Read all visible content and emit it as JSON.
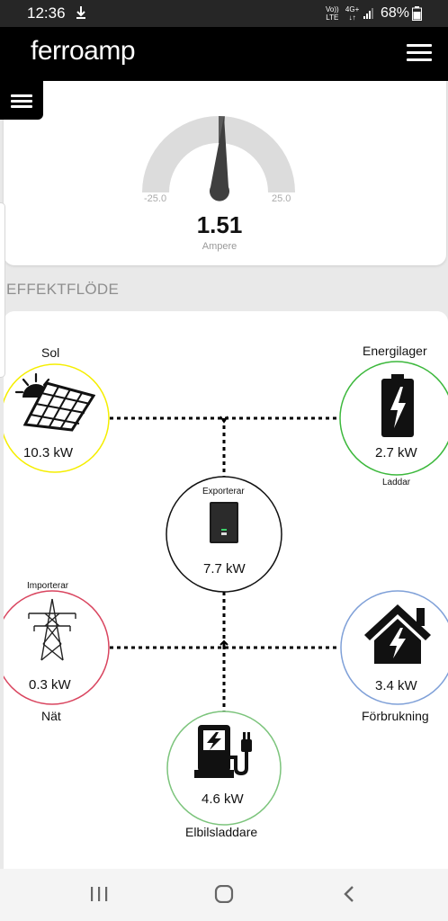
{
  "status_bar": {
    "time": "12:36",
    "network_top": [
      "Vo))",
      "4G+"
    ],
    "network_bottom": [
      "LTE",
      "↓↑"
    ],
    "battery": "68%",
    "icons": [
      "download-icon",
      "signal-icon",
      "battery-icon"
    ]
  },
  "app": {
    "logo": "ferroamp",
    "menu_icon": "hamburger-menu-icon"
  },
  "gauge": {
    "min": "-25.0",
    "max": "25.0",
    "value": "1.51",
    "unit": "Ampere"
  },
  "section": {
    "title": "EFFEKTFLÖDE"
  },
  "flow": {
    "solar": {
      "name": "Sol",
      "power": "10.3 kW",
      "color": "#f5ee00",
      "icon": "solar-panel-icon"
    },
    "battery": {
      "name": "Energilager",
      "power": "2.7 kW",
      "status": "Laddar",
      "color": "#3cb83c",
      "icon": "battery-icon"
    },
    "inverter": {
      "status": "Exporterar",
      "power": "7.7 kW",
      "color": "#111111",
      "icon": "inverter-icon"
    },
    "grid": {
      "name": "Nät",
      "power": "0.3 kW",
      "status": "Importerar",
      "color": "#d9455f",
      "icon": "power-tower-icon"
    },
    "consumption": {
      "name": "Förbrukning",
      "power": "3.4 kW",
      "color": "#7fa0d8",
      "icon": "house-icon"
    },
    "ev_charger": {
      "name": "Elbilsladdare",
      "power": "4.6 kW",
      "color": "#7cc47c",
      "icon": "ev-charger-icon"
    }
  },
  "nav": {
    "buttons": [
      "recent-apps-icon",
      "home-icon",
      "back-icon"
    ]
  }
}
